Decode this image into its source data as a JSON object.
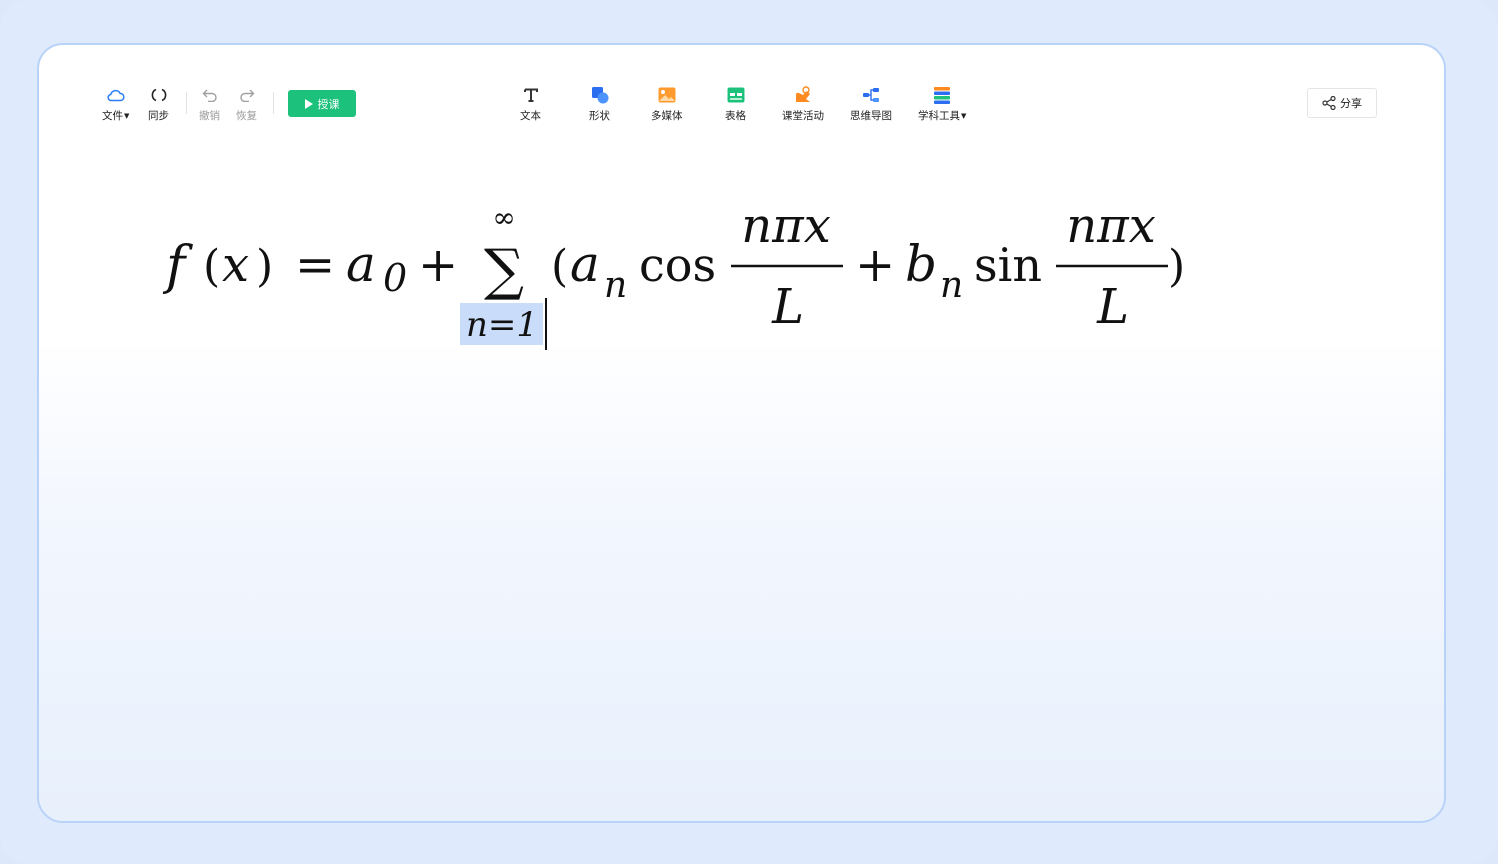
{
  "toolbar": {
    "file": {
      "label": "文件",
      "icon": "cloud-icon"
    },
    "sync": {
      "label": "同步",
      "icon": "sync-icon"
    },
    "undo": {
      "label": "撤销",
      "icon": "undo-icon"
    },
    "redo": {
      "label": "恢复",
      "icon": "redo-icon"
    },
    "teach": {
      "label": "授课",
      "icon": "play-icon"
    },
    "text": {
      "label": "文本",
      "icon": "text-icon"
    },
    "shape": {
      "label": "形状",
      "icon": "shape-icon"
    },
    "media": {
      "label": "多媒体",
      "icon": "image-icon"
    },
    "table": {
      "label": "表格",
      "icon": "table-icon"
    },
    "activity": {
      "label": "课堂活动",
      "icon": "activity-icon"
    },
    "mindmap": {
      "label": "思维导图",
      "icon": "mindmap-icon"
    },
    "subject": {
      "label": "学科工具",
      "icon": "subject-tools-icon"
    },
    "share": {
      "label": "分享",
      "icon": "share-icon"
    }
  },
  "formula": {
    "f": "f",
    "lparen_x": "(",
    "x": "x",
    "rparen_x": ")",
    "equals": "=",
    "a": "a",
    "sub0": "0",
    "plus1": "+",
    "sigma": "∑",
    "sum_upper": "∞",
    "sum_lower": "n=1",
    "lparen": "(",
    "a2": "a",
    "subn1": "n",
    "cos": "cos",
    "num1": "nπx",
    "den1": "L",
    "plus2": "+",
    "b": "b",
    "subn2": "n",
    "sin": "sin",
    "num2": "nπx",
    "den2": "L",
    "rparen": ")"
  },
  "colors": {
    "accent": "#1cc17c",
    "selection": "#c9dcfa",
    "frame": "#dfeafc",
    "board_border": "#b9d3f8"
  }
}
